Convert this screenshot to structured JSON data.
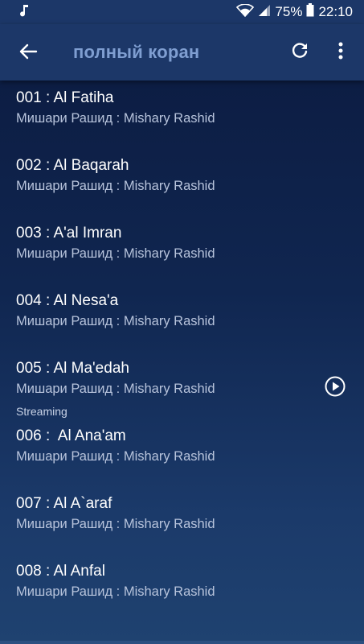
{
  "status_bar": {
    "battery_percent": "75%",
    "time": "22:10",
    "icons": [
      "music-note-icon",
      "wifi-icon",
      "signal-icon",
      "battery-icon"
    ]
  },
  "app_bar": {
    "title": "полный коран",
    "icons": [
      "back-arrow-icon",
      "refresh-icon",
      "more-vert-icon"
    ]
  },
  "colors": {
    "bar_background": "#1c3768",
    "title_color": "#7f9ed1",
    "subtitle_color": "#b8c4dc",
    "background_top": "#0b1a3f",
    "background_bottom": "#1f4270"
  },
  "tracks": [
    {
      "title": "001 : Al Fatiha",
      "subtitle": "Мишари Рашид : Mishary Rashid"
    },
    {
      "title": "002 : Al Baqarah",
      "subtitle": "Мишари Рашид : Mishary Rashid"
    },
    {
      "title": "003 : A'al Imran",
      "subtitle": "Мишари Рашид : Mishary Rashid"
    },
    {
      "title": "004 : Al Nesa'a",
      "subtitle": "Мишари Рашид : Mishary Rashid"
    },
    {
      "title": "005 : Al Ma'edah",
      "subtitle": "Мишари Рашид : Mishary Rashid",
      "status": "Streaming",
      "action_icon": "play-circle-icon"
    },
    {
      "title": "006 :  Al Ana'am",
      "subtitle": "Мишари Рашид : Mishary Rashid"
    },
    {
      "title": "007 : Al A`araf",
      "subtitle": "Мишари Рашид : Mishary Rashid"
    },
    {
      "title": "008 : Al Anfal",
      "subtitle": "Мишари Рашид : Mishary Rashid"
    }
  ]
}
